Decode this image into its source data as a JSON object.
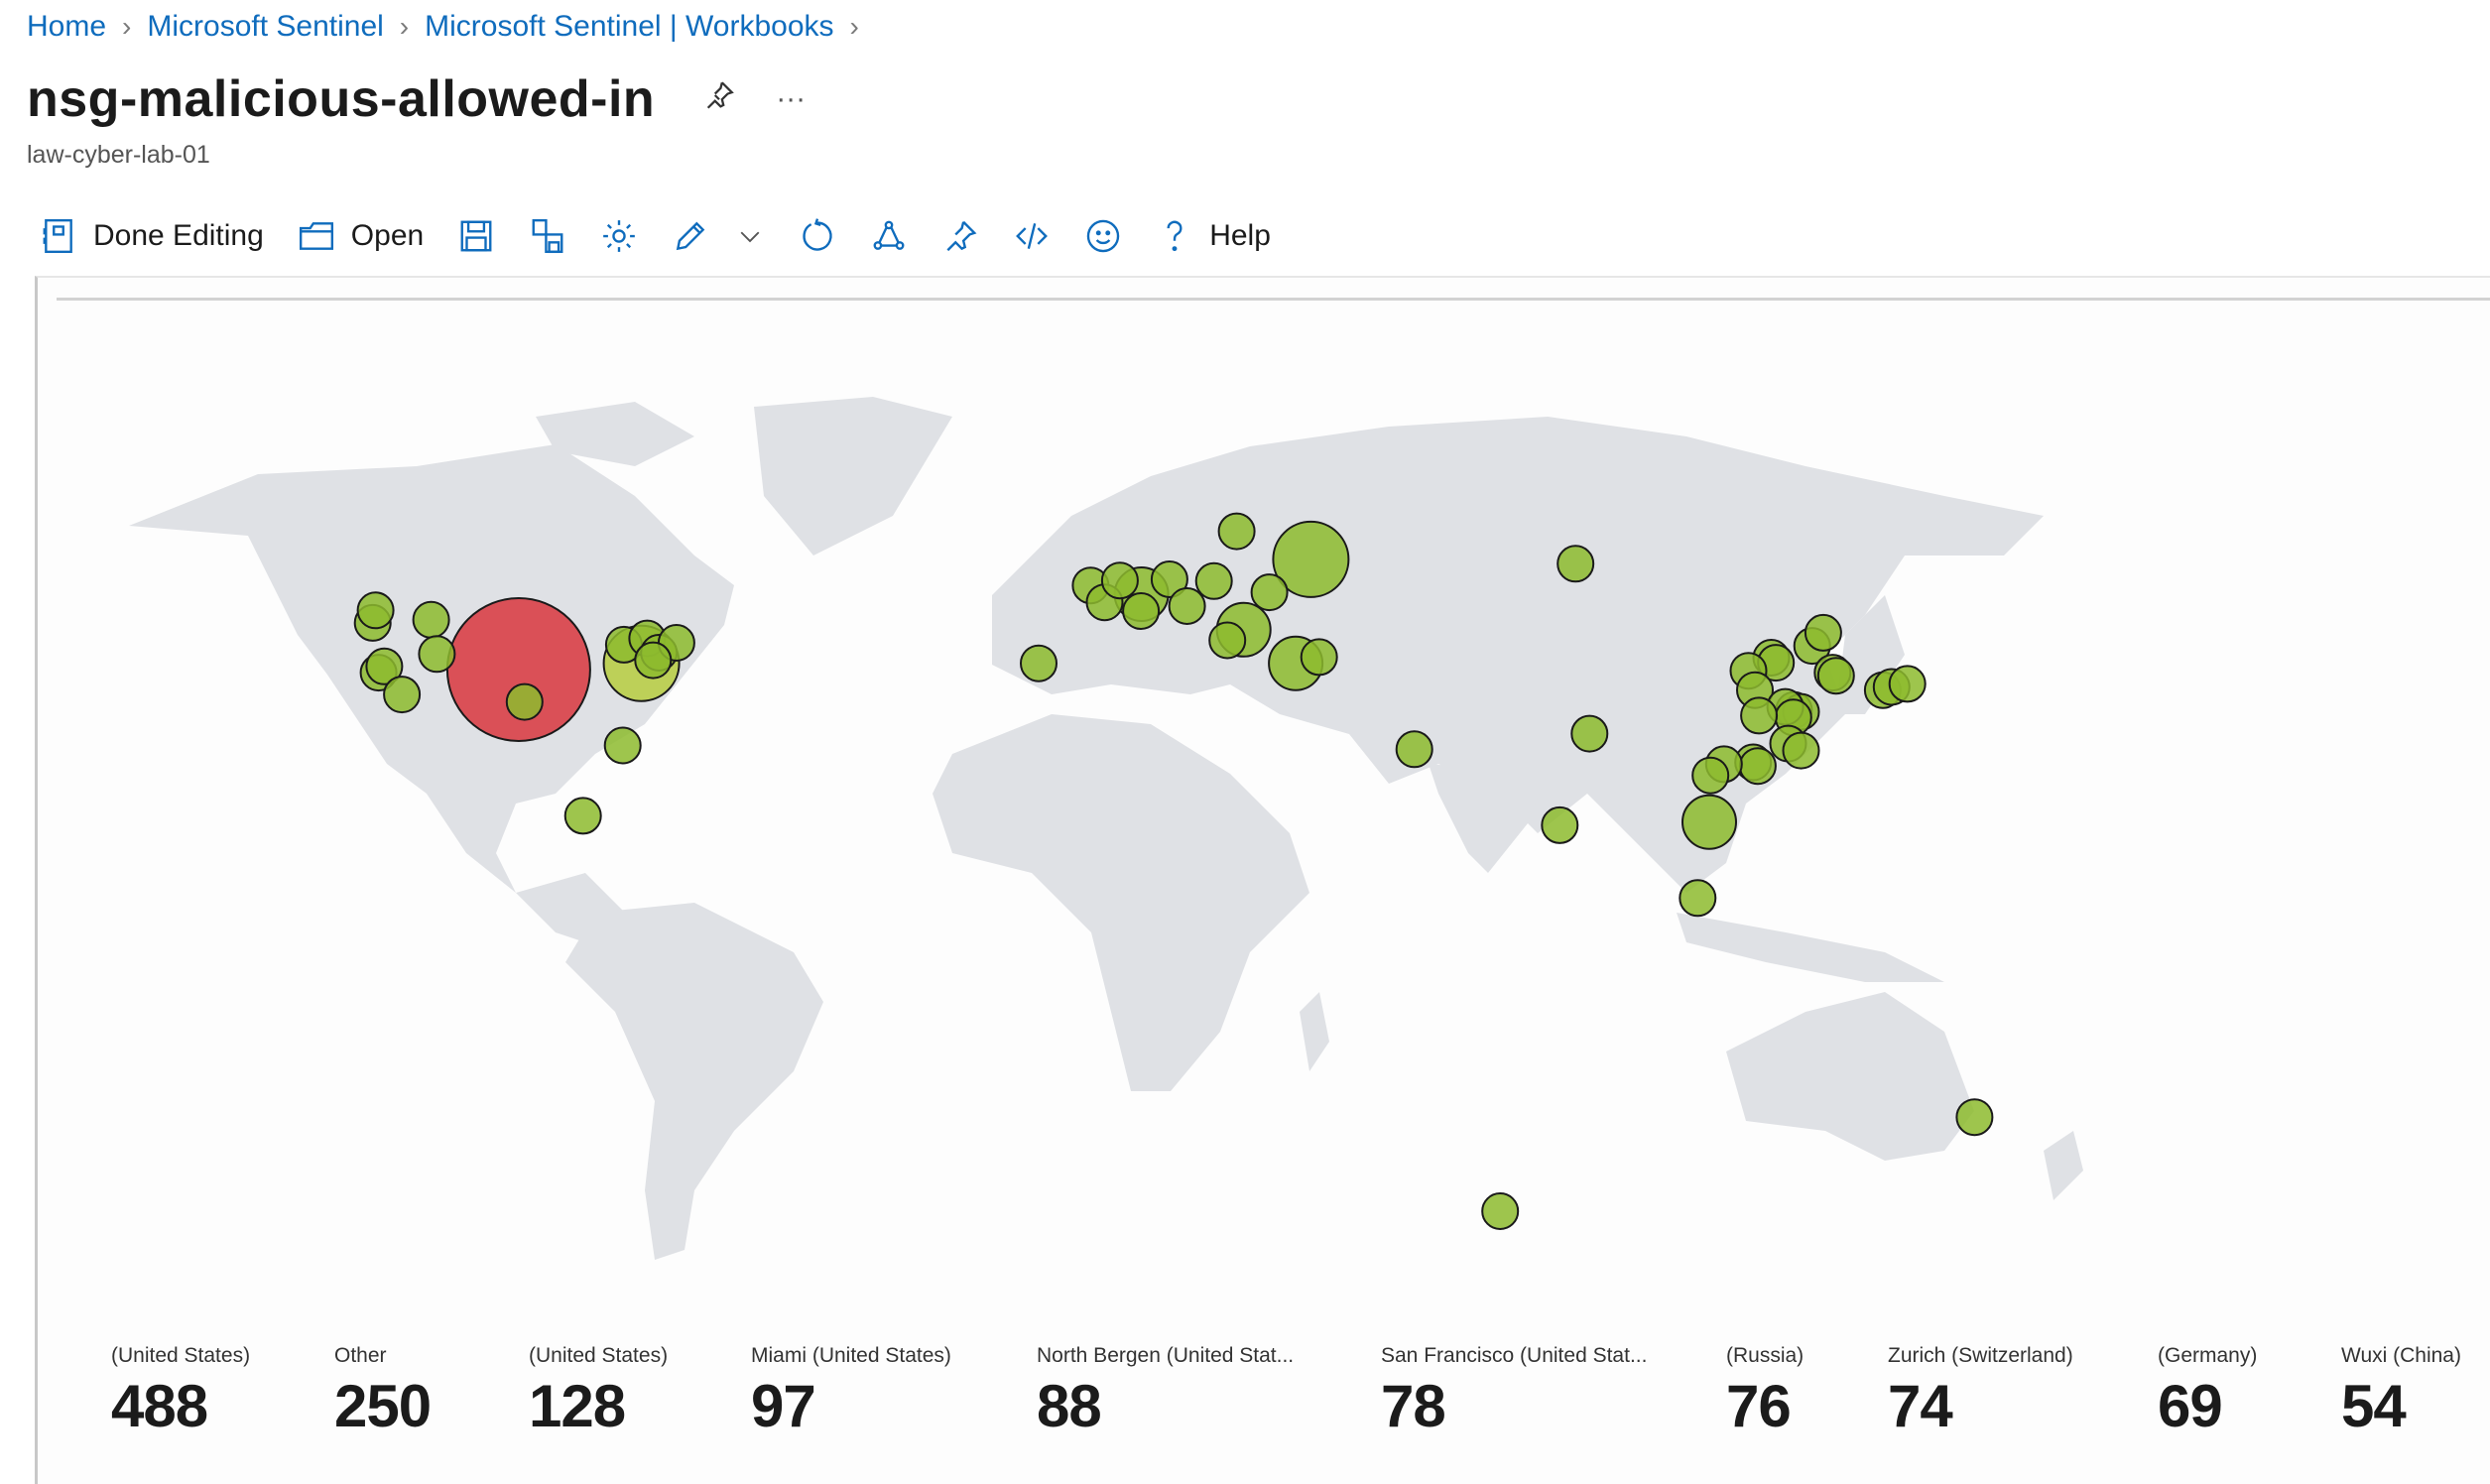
{
  "breadcrumb": [
    {
      "label": "Home"
    },
    {
      "label": "Microsoft Sentinel"
    },
    {
      "label": "Microsoft Sentinel | Workbooks"
    }
  ],
  "header": {
    "title": "nsg-malicious-allowed-in",
    "subtitle": "law-cyber-lab-01",
    "pin_icon": "pin-icon",
    "more_icon": "more-icon",
    "more_glyph": "···"
  },
  "toolbar": {
    "done_editing": "Done Editing",
    "open": "Open",
    "help": "Help",
    "icons": [
      "done-editing-icon",
      "open-folder-icon",
      "save-icon",
      "save-as-icon",
      "settings-gear-icon",
      "edit-pencil-icon",
      "chevron-down-icon",
      "refresh-icon",
      "share-icon",
      "pin-icon",
      "code-icon",
      "feedback-smiley-icon",
      "help-question-icon"
    ],
    "accent": "#0f6cbd"
  },
  "map": {
    "land_color": "#dfe1e5",
    "bubble_color_default": "#8dbb2e",
    "bubble_color_top": "#d9434b",
    "bubble_color_mid": "#b7cc3f",
    "bubbles": [
      {
        "region": "North America",
        "lon": -98,
        "lat": 38,
        "size": "xl",
        "color": "top"
      },
      {
        "region": "North America",
        "lon": -77,
        "lat": 39,
        "size": "l",
        "color": "mid"
      },
      {
        "region": "North America",
        "lon": -122,
        "lat": 37.5,
        "size": "s"
      },
      {
        "region": "North America",
        "lon": -121,
        "lat": 38.5,
        "size": "s"
      },
      {
        "region": "North America",
        "lon": -123,
        "lat": 45.5,
        "size": "s"
      },
      {
        "region": "North America",
        "lon": -122.5,
        "lat": 47.5,
        "size": "s"
      },
      {
        "region": "North America",
        "lon": -113,
        "lat": 46,
        "size": "s"
      },
      {
        "region": "North America",
        "lon": -118,
        "lat": 34,
        "size": "s"
      },
      {
        "region": "North America",
        "lon": -112,
        "lat": 40.5,
        "size": "s"
      },
      {
        "region": "North America",
        "lon": -97,
        "lat": 32.8,
        "size": "s"
      },
      {
        "region": "North America",
        "lon": -80.2,
        "lat": 25.8,
        "size": "s"
      },
      {
        "region": "North America",
        "lon": -87,
        "lat": 14.5,
        "size": "s"
      },
      {
        "region": "North America",
        "lon": -80,
        "lat": 42,
        "size": "s"
      },
      {
        "region": "North America",
        "lon": -76,
        "lat": 43,
        "size": "s"
      },
      {
        "region": "North America",
        "lon": -74,
        "lat": 40.7,
        "size": "s"
      },
      {
        "region": "North America",
        "lon": -71,
        "lat": 42.3,
        "size": "s"
      },
      {
        "region": "North America",
        "lon": -75,
        "lat": 39.5,
        "size": "s"
      },
      {
        "region": "Europe",
        "lon": -9,
        "lat": 39,
        "size": "s"
      },
      {
        "region": "Europe",
        "lon": -0.1,
        "lat": 51.5,
        "size": "s"
      },
      {
        "region": "Europe",
        "lon": 2.3,
        "lat": 48.8,
        "size": "s"
      },
      {
        "region": "Europe",
        "lon": 4.9,
        "lat": 52.3,
        "size": "s"
      },
      {
        "region": "Europe",
        "lon": 8.6,
        "lat": 50.1,
        "size": "m"
      },
      {
        "region": "Europe",
        "lon": 8.5,
        "lat": 47.4,
        "size": "s"
      },
      {
        "region": "Europe",
        "lon": 13.4,
        "lat": 52.5,
        "size": "s"
      },
      {
        "region": "Europe",
        "lon": 16.4,
        "lat": 48.2,
        "size": "s"
      },
      {
        "region": "Europe",
        "lon": 21,
        "lat": 52.2,
        "size": "s"
      },
      {
        "region": "Europe",
        "lon": 24.9,
        "lat": 60.2,
        "size": "s"
      },
      {
        "region": "Europe",
        "lon": 26.1,
        "lat": 44.4,
        "size": "m"
      },
      {
        "region": "Europe",
        "lon": 23.3,
        "lat": 42.7,
        "size": "s"
      },
      {
        "region": "Europe",
        "lon": 30.5,
        "lat": 50.4,
        "size": "s"
      },
      {
        "region": "Europe",
        "lon": 37.6,
        "lat": 55.7,
        "size": "l"
      },
      {
        "region": "Middle East",
        "lon": 35,
        "lat": 39,
        "size": "m"
      },
      {
        "region": "Middle East",
        "lon": 39,
        "lat": 40,
        "size": "s"
      },
      {
        "region": "Middle East",
        "lon": 55.3,
        "lat": 25.2,
        "size": "s"
      },
      {
        "region": "Asia",
        "lon": 82.9,
        "lat": 55,
        "size": "s"
      },
      {
        "region": "Asia",
        "lon": 85.3,
        "lat": 27.7,
        "size": "s"
      },
      {
        "region": "Asia",
        "lon": 80.2,
        "lat": 13,
        "size": "s"
      },
      {
        "region": "Asia",
        "lon": 116.4,
        "lat": 39.9,
        "size": "s"
      },
      {
        "region": "Asia",
        "lon": 117.2,
        "lat": 39.1,
        "size": "s"
      },
      {
        "region": "Asia",
        "lon": 112.5,
        "lat": 37.8,
        "size": "s"
      },
      {
        "region": "Asia",
        "lon": 113.6,
        "lat": 34.7,
        "size": "s"
      },
      {
        "region": "Asia",
        "lon": 123.4,
        "lat": 41.8,
        "size": "s"
      },
      {
        "region": "Asia",
        "lon": 125.3,
        "lat": 43.9,
        "size": "s"
      },
      {
        "region": "Asia",
        "lon": 120.3,
        "lat": 31.5,
        "size": "s"
      },
      {
        "region": "Asia",
        "lon": 121.5,
        "lat": 31.2,
        "size": "s"
      },
      {
        "region": "Asia",
        "lon": 118.8,
        "lat": 32,
        "size": "s"
      },
      {
        "region": "Asia",
        "lon": 120.2,
        "lat": 30.3,
        "size": "s"
      },
      {
        "region": "Asia",
        "lon": 114.3,
        "lat": 30.6,
        "size": "s"
      },
      {
        "region": "Asia",
        "lon": 119.3,
        "lat": 26.1,
        "size": "s"
      },
      {
        "region": "Asia",
        "lon": 121.5,
        "lat": 25,
        "size": "s"
      },
      {
        "region": "Asia",
        "lon": 113.3,
        "lat": 23.1,
        "size": "s"
      },
      {
        "region": "Asia",
        "lon": 114.1,
        "lat": 22.5,
        "size": "s"
      },
      {
        "region": "Asia",
        "lon": 108.3,
        "lat": 22.8,
        "size": "s"
      },
      {
        "region": "Asia",
        "lon": 106,
        "lat": 21,
        "size": "s"
      },
      {
        "region": "Asia",
        "lon": 126.9,
        "lat": 37.5,
        "size": "s"
      },
      {
        "region": "Asia",
        "lon": 127.5,
        "lat": 37,
        "size": "s"
      },
      {
        "region": "Asia",
        "lon": 135.5,
        "lat": 34.7,
        "size": "s"
      },
      {
        "region": "Asia",
        "lon": 137,
        "lat": 35.2,
        "size": "s"
      },
      {
        "region": "Asia",
        "lon": 139.7,
        "lat": 35.7,
        "size": "s"
      },
      {
        "region": "Asia",
        "lon": 105.8,
        "lat": 13.5,
        "size": "m"
      },
      {
        "region": "Asia",
        "lon": 103.8,
        "lat": 1.3,
        "size": "s"
      },
      {
        "region": "Oceania",
        "lon": 151.2,
        "lat": -33.9,
        "size": "s"
      },
      {
        "region": "Southern Ocean",
        "lon": 70,
        "lat": -49,
        "size": "s"
      }
    ]
  },
  "tiles": [
    {
      "label": "(United States)",
      "value": "488"
    },
    {
      "label": "Other",
      "value": "250"
    },
    {
      "label": "(United States)",
      "value": "128"
    },
    {
      "label": "Miami (United States)",
      "value": "97"
    },
    {
      "label": "North Bergen (United Stat...",
      "value": "88"
    },
    {
      "label": "San Francisco (United Stat...",
      "value": "78"
    },
    {
      "label": "(Russia)",
      "value": "76"
    },
    {
      "label": "Zurich (Switzerland)",
      "value": "74"
    },
    {
      "label": "(Germany)",
      "value": "69"
    },
    {
      "label": "Wuxi (China)",
      "value": "54"
    }
  ]
}
